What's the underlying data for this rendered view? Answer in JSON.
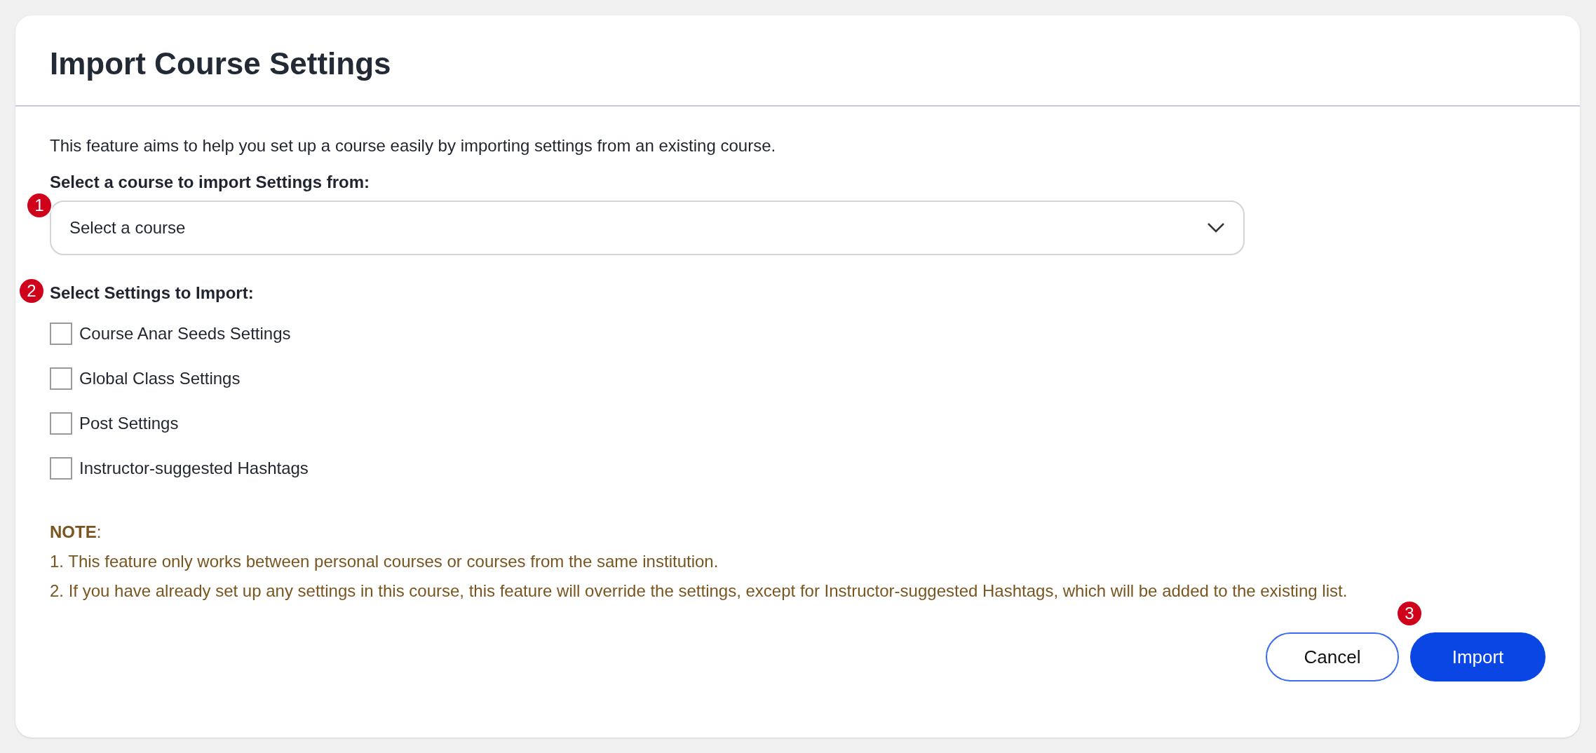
{
  "dialog": {
    "title": "Import Course Settings"
  },
  "intro": "This feature aims to help you set up a course easily by importing settings from an existing course.",
  "course_select": {
    "label": "Select a course to import Settings from:",
    "badge": "1",
    "placeholder": "Select a course"
  },
  "settings": {
    "label": "Select Settings to Import:",
    "badge": "2",
    "options": [
      {
        "label": "Course Anar Seeds Settings",
        "checked": false
      },
      {
        "label": "Global Class Settings",
        "checked": false
      },
      {
        "label": "Post Settings",
        "checked": false
      },
      {
        "label": "Instructor-suggested Hashtags",
        "checked": false
      }
    ]
  },
  "note": {
    "heading": "**NOTE**:",
    "items": [
      "1. This feature only works between personal courses or courses from the same institution.",
      "2. If you have already set up any settings in this course, this feature will override the settings, except for Instructor-suggested Hashtags, which will be added to the existing list."
    ]
  },
  "buttons": {
    "cancel": "Cancel",
    "import": "Import",
    "import_badge": "3"
  }
}
